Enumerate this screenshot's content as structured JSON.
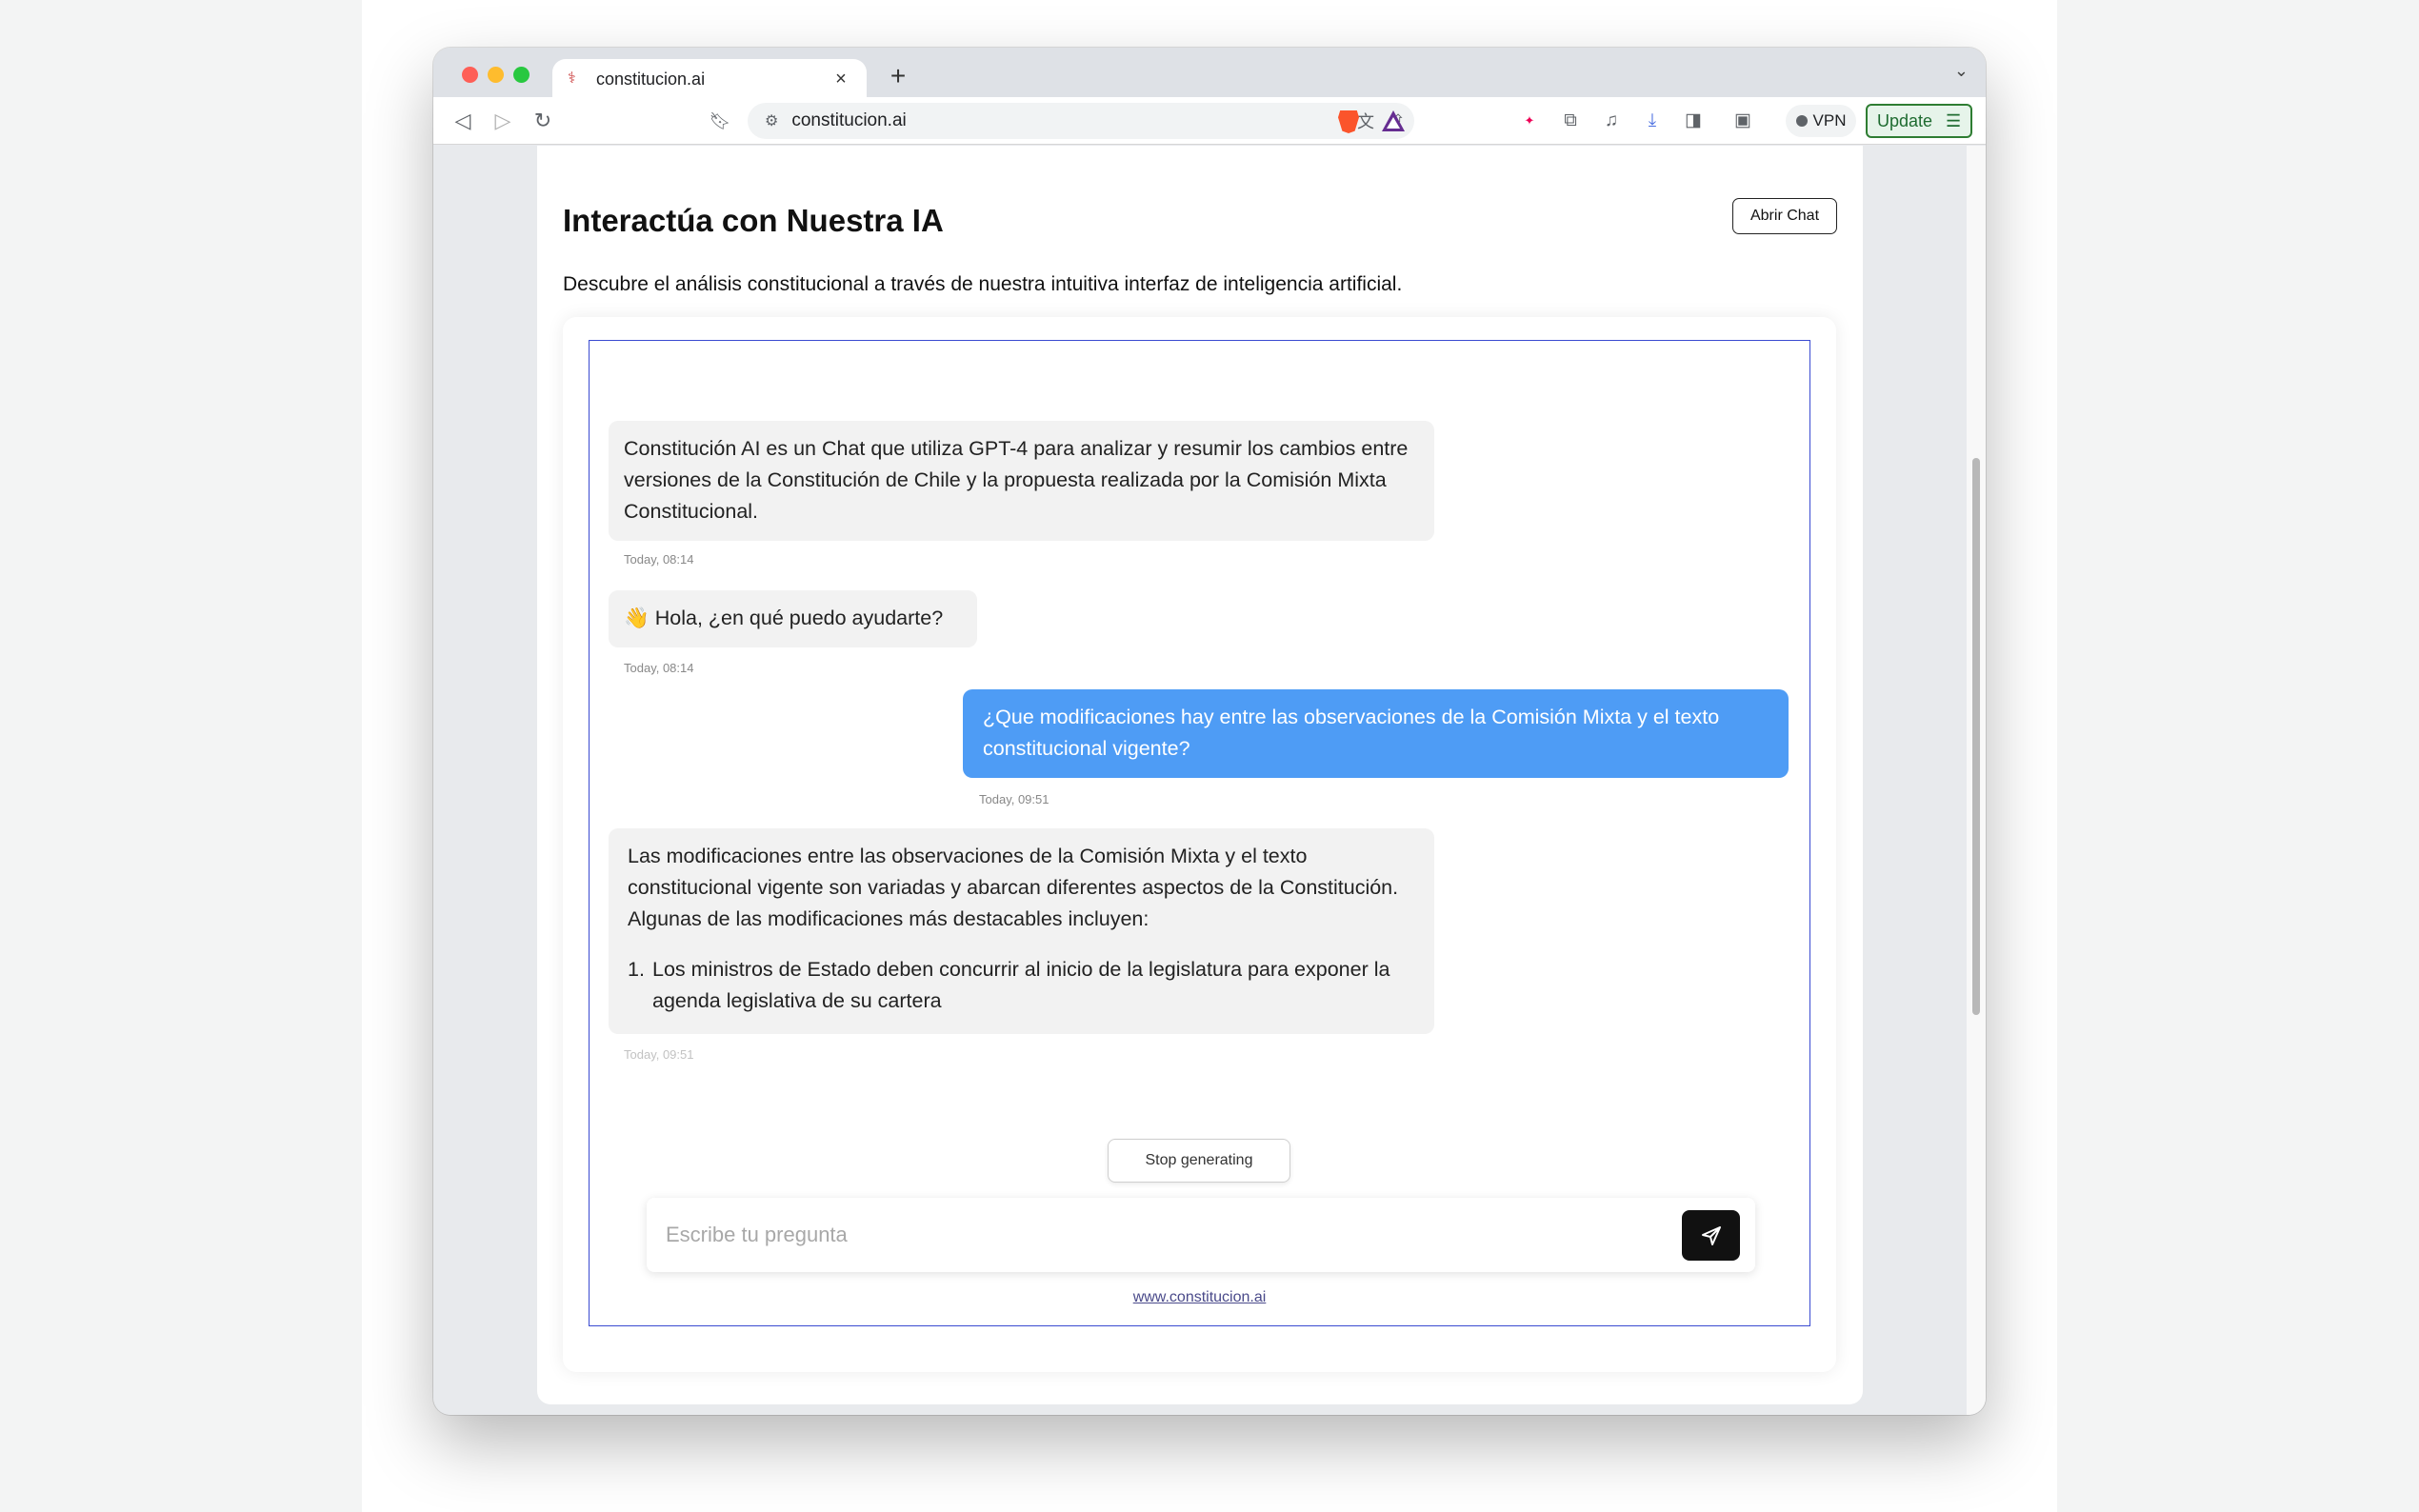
{
  "browser": {
    "tab_title": "constitucion.ai",
    "tab_close": "×",
    "new_tab": "+",
    "url": "constitucion.ai",
    "vpn_label": "VPN",
    "update_label": "Update"
  },
  "page": {
    "title": "Interactúa con Nuestra IA",
    "open_chat_label": "Abrir Chat",
    "description": "Descubre el análisis constitucional a través de nuestra intuitiva interfaz de inteligencia artificial."
  },
  "chat": {
    "messages": [
      {
        "role": "bot",
        "text": "Constitución AI es un Chat que utiliza GPT-4 para analizar y resumir los cambios entre versiones de la Constitución de Chile y la propuesta realizada por la Comisión Mixta Constitucional.",
        "time": "Today, 08:14"
      },
      {
        "role": "bot",
        "text": "👋 Hola, ¿en qué puedo ayudarte?",
        "time": "Today, 08:14"
      },
      {
        "role": "user",
        "text": "¿Que modificaciones hay entre las observaciones de la Comisión Mixta y el texto constitucional vigente?",
        "time": "Today, 09:51"
      },
      {
        "role": "bot",
        "text": "Las modificaciones entre las observaciones de la Comisión Mixta y el texto constitucional vigente son variadas y abarcan diferentes aspectos de la Constitución. Algunas de las modificaciones más destacables incluyen:",
        "list_item_number": "1.",
        "list_item": "Los ministros de Estado deben concurrir al inicio de la legislatura para exponer la agenda legislativa de su cartera",
        "time": "Today, 09:51"
      }
    ],
    "stop_label": "Stop generating",
    "input_placeholder": "Escribe tu pregunta",
    "footer_link": "www.constitucion.ai"
  },
  "colors": {
    "user_bubble": "#4e9cf5",
    "bot_bubble": "#f2f2f2",
    "chat_border": "#3a4bd1",
    "send_button": "#111111",
    "update_accent": "#2e7d32"
  }
}
